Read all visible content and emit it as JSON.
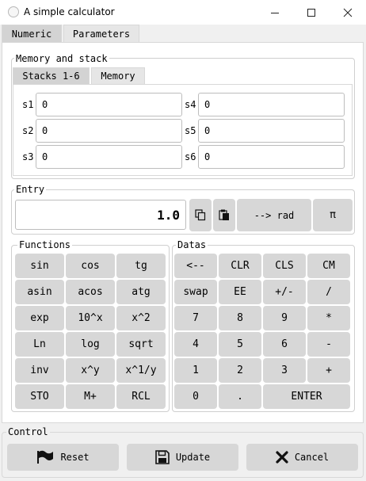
{
  "window": {
    "title": "A simple calculator"
  },
  "tabs": [
    "Numeric",
    "Parameters"
  ],
  "memory_group": {
    "title": "Memory and stack",
    "tabs": [
      "Stacks 1-6",
      "Memory"
    ],
    "stacks": [
      {
        "label": "s1",
        "value": "0"
      },
      {
        "label": "s2",
        "value": "0"
      },
      {
        "label": "s3",
        "value": "0"
      },
      {
        "label": "s4",
        "value": "0"
      },
      {
        "label": "s5",
        "value": "0"
      },
      {
        "label": "s6",
        "value": "0"
      }
    ]
  },
  "entry": {
    "title": "Entry",
    "value": "1.0",
    "mode_button": "--> rad",
    "pi_button": "π"
  },
  "functions": {
    "title": "Functions",
    "buttons": [
      "sin",
      "cos",
      "tg",
      "asin",
      "acos",
      "atg",
      "exp",
      "10^x",
      "x^2",
      "Ln",
      "log",
      "sqrt",
      "inv",
      "x^y",
      "x^1/y",
      "STO",
      "M+",
      "RCL"
    ]
  },
  "datas": {
    "title": "Datas",
    "buttons": [
      "<--",
      "CLR",
      "CLS",
      "CM",
      "swap",
      "EE",
      "+/-",
      "/",
      "7",
      "8",
      "9",
      "*",
      "4",
      "5",
      "6",
      "-",
      "1",
      "2",
      "3",
      "+",
      "0",
      ".",
      "ENTER"
    ]
  },
  "control": {
    "title": "Control",
    "reset": "Reset",
    "update": "Update",
    "cancel": "Cancel"
  }
}
